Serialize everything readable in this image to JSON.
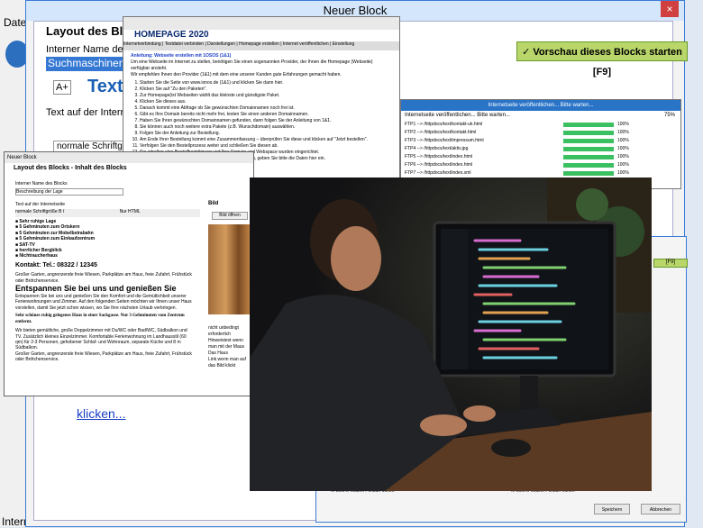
{
  "background_app": {
    "menu": "Datei",
    "footer": "Interne"
  },
  "main_window": {
    "title": "Neuer Block",
    "close": "×",
    "layout_title": "Layout des Blocks",
    "internal_name_label": "Interner Name des",
    "internal_name_value": "Suchmaschinene",
    "text_icon": "A+",
    "text_label": "Text ",
    "text_on_internet_label": "Text auf der Intern",
    "font_value": "normale Schriftgröß",
    "link_text": "klicken...",
    "preview_button": "Vorschau dieses Blocks starten [F9]"
  },
  "homepage_window": {
    "title": "HOMEPAGE 2020",
    "toolbar_items": [
      "Internetverbindung",
      "Textdatei verbinden",
      "Darstellungen",
      "Homepage erstellen",
      "Internet veröffentlichen",
      "Einstellung"
    ],
    "heading": "Anleitung: Webseite erstellen mit 1OSOS (1&1)",
    "paragraphs": [
      "Um eine Webseite im Internet zu stellen, benötigen Sie einen sogenannten Provider, der Ihnen die Homepage (Webseite) verfügbar ansteht.",
      "Wir empfehlen Ihnen den Provider (1&1) mit dem eine unserer Kunden gute Erfahrungen gemacht haben."
    ],
    "steps": [
      "Starten Sie die Seite von www.ionos.de (1&1) und klicken Sie dann hier.",
      "Klicken Sie auf \"Zu den Paketen\".",
      "Zur Homepage(ist Webseiten wählt das kleinste und günstigste Paket.",
      "Klicken Sie dieses aus.",
      "Danach kommt eine Abfrage ob Sie gewünschten Domainnamen noch frei ist.",
      "Gibt es Ihre Domain bereits nicht mehr frei, testen Sie einen anderen Domainnamen.",
      "Haben Sie Ihren gewünschten Domainnamen gefunden, dann folgen Sie der Anleitung von 1&1.",
      "Sie können auch noch weitere extra Pakete (z.B. Wunschdomain) auswählen.",
      "Folgen Sie der Anleitung zur Bestellung.",
      "Am Ende Ihrer Bestellung kommt eine Zusammenfassung – überprüfen Sie diese und klicken auf \"Jetzt bestellen\".",
      "Verfolgen Sie den Bestellprozess weiter und schließen Sie diesen ab.",
      "Sie erhalten eine Bestellbestätigung und Ihre Domain und Webspace wurden eingerichtet.",
      "Wenn Sie Ihre Zugangsdaten von 1OSOS erhalten haben, geben Sie bitte die Daten hier ein."
    ]
  },
  "upload_window": {
    "title": "Internetseite veröffentlichen... Bitte warten...",
    "header": "Internetseite veröffentlichen... Bitte warten...",
    "total_percent": "75%",
    "rows": [
      {
        "label": "FTP1 --> /httpdocs/text/kontakt-uk.html",
        "pct": "100%"
      },
      {
        "label": "FTP2 --> /httpdocs/text/kontakt.html",
        "pct": "100%"
      },
      {
        "label": "FTP3 --> /httpdocs/text/impressum.html",
        "pct": "100%"
      },
      {
        "label": "FTP4 --> /httpdocs/text/aktiv.jpg",
        "pct": "100%"
      },
      {
        "label": "FTP5 --> /httpdocs/text/index.html",
        "pct": "100%"
      },
      {
        "label": "FTP6 --> /httpdocs/text/index.html",
        "pct": "100%"
      },
      {
        "label": "FTP7 --> /httpdocs/text/index.xml",
        "pct": "100%"
      }
    ]
  },
  "editor_window": {
    "titlebar": "Neuer Block",
    "title": "Layout des Blocks - Inhalt des Blocks",
    "name_label": "Interner Name des Blocks",
    "name_value": "Beschreibung der Lage",
    "text_label": "Text auf der Internetseite",
    "font_value": "normale Schriftgröße",
    "html_toggle": "Nur HTML",
    "bullets": [
      "Sehr ruhige Lage",
      "5 Gehminuten zum Ortskern",
      "5 Gehminuten zur Mobelbstrabahn",
      "5 Gehminuten zum Einkaufzentrum",
      "SAT-TV",
      "herrlicher Bergblick",
      "Nichtraucherhaus"
    ],
    "contact": "Kontakt: Tel.: 08322 / 12345",
    "para1": "Großer Garten, angrenzende freie Wiesen, Parkplätze am Haus, freie Zufahrt, Frühstück oder Brötchenservice.",
    "heading": "Entspannen Sie bei uns und genießen Sie",
    "para2": "Entspannen Sie bei uns und genießen Sie den Komfort und die Gemütlichkeit unserer Ferienwohnungen und Zimmer. Auf den folgenden Seiten möchten wir Ihnen unser Haus vorstellen, damit Sie jetzt schon wissen, wo Sie Ihre nächsten Urlaub verbringen.",
    "bold_line": "Sehr schönes ruhig gelegenes Haus in einer Sackgasse. Nur 3 Gehminuten vom Zentrum entfernt.",
    "para3": "Wir bieten gemütliche, große Doppelzimmer mit Du/WC oder Bad/WC, Südbalkon und TV. Zusätzlich kleines Einzelzimmer. Komfortable Ferienwohnung im Landhausstil (60 qm) für 2-3 Personen, gehobener Schlaf- und Wohnraum, separate Küche und 8 m Südbalkon.",
    "para4": "Großer Garten, angrenzende freie Wiesen, Parkplätze am Haus, freie Zufahrt, Frühstück oder Brötchenservice.",
    "bild_label": "Bild",
    "bild_button": "Bild öffnen",
    "right_text": [
      "nicht unbedingt erforderlich",
      "Hinweistext wenn man mit der Maus",
      "Das Haus",
      "Link wenn man auf das Bild klickt"
    ]
  },
  "right_dialog": {
    "green_button": "[F9]",
    "check1": "Link in neuem Fenster öffnen",
    "check2": "Link in neuem Fenster öffnen",
    "save": "Speichern",
    "cancel": "Abbrechen"
  },
  "photo": {
    "subject": "person-typing-at-computer-with-code-on-monitor"
  }
}
